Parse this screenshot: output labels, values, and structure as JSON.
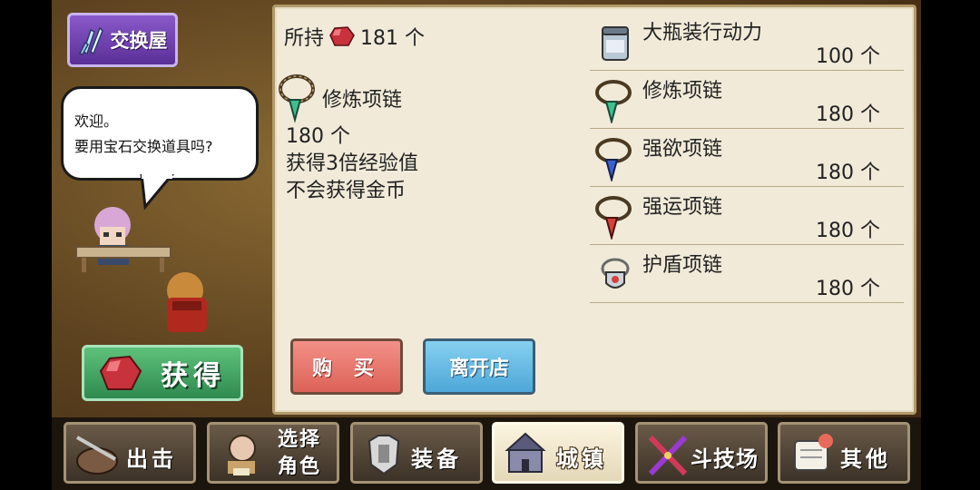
{
  "shop": {
    "title": "交换屋"
  },
  "dialog": {
    "line1": "欢迎。",
    "line2": "要用宝石交换道具吗?"
  },
  "get_button": {
    "label": "获得"
  },
  "owned": {
    "prefix": "所持",
    "count": "181 个"
  },
  "selected_item": {
    "name": "修炼项链",
    "price": "180 个",
    "effect1": "获得3倍经验值",
    "effect2": "不会获得金币"
  },
  "items": [
    {
      "name": "大瓶装行动力",
      "price": "100 个",
      "icon": "bottle-icon"
    },
    {
      "name": "修炼项链",
      "price": "180 个",
      "icon": "necklace-green-icon"
    },
    {
      "name": "强欲项链",
      "price": "180 个",
      "icon": "necklace-blue-icon"
    },
    {
      "name": "强运项链",
      "price": "180 个",
      "icon": "necklace-red-icon"
    },
    {
      "name": "护盾项链",
      "price": "180 个",
      "icon": "shield-necklace-icon"
    }
  ],
  "buttons": {
    "buy": "购 买",
    "leave": "离开店"
  },
  "nav": {
    "sortie": "出击",
    "select_line1": "选择",
    "select_line2": "角色",
    "equip": "装备",
    "town": "城镇",
    "arena": "斗技场",
    "other": "其他"
  },
  "colors": {
    "gem_red": "#c8323c",
    "panel": "#f1ead9",
    "buy": "#dc6257",
    "leave": "#4ea7d8",
    "get": "#2f8a4f"
  }
}
